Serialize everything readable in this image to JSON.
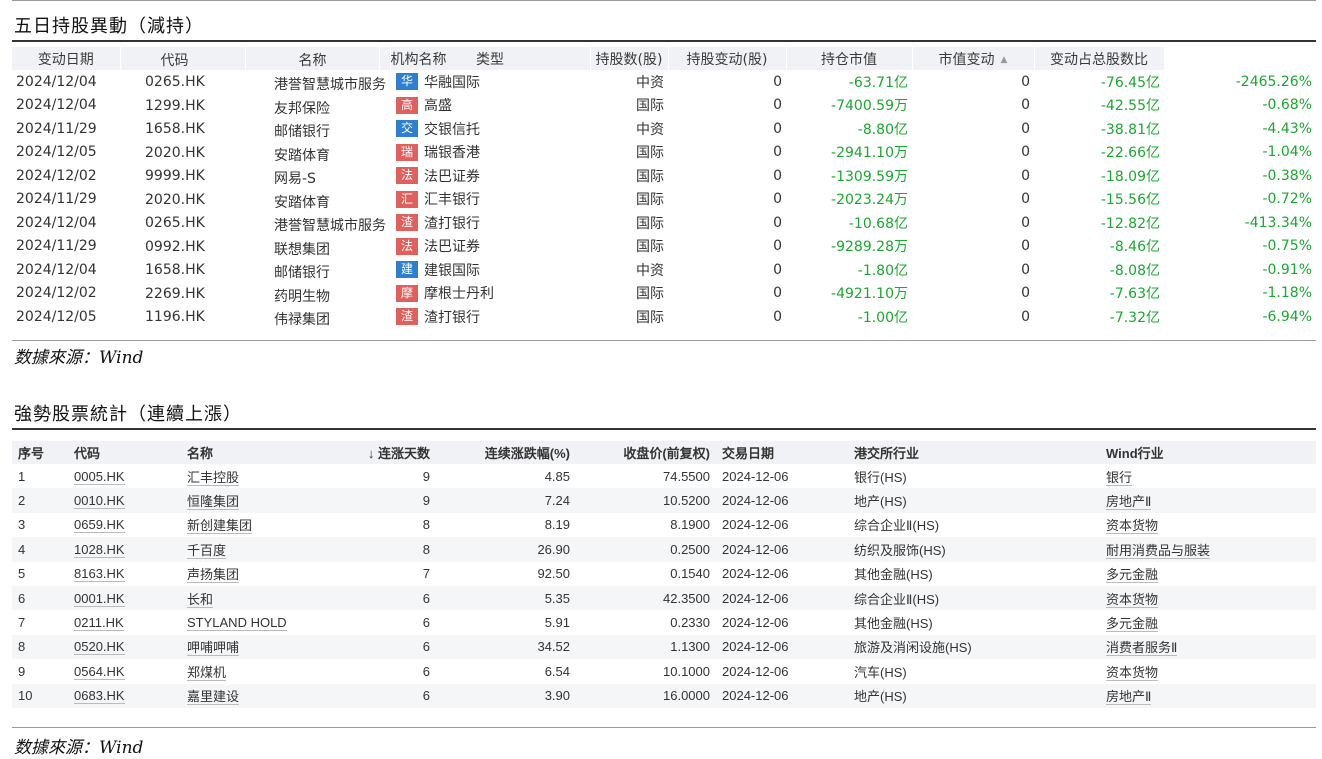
{
  "section1": {
    "title": "五日持股異動（減持）",
    "headers": [
      "变动日期",
      "代码",
      "名称",
      "机构名称",
      "类型",
      "持股数(股)",
      "持股变动(股)",
      "持仓市值",
      "市值变动",
      "变动占总股数比"
    ],
    "rows": [
      {
        "date": "2024/12/04",
        "code": "0265.HK",
        "name": "港誉智慧城市服务",
        "badge": "华",
        "badge_color": "#2e7fd0",
        "inst": "华融国际",
        "type": "中资",
        "shares": "0",
        "change": "-63.71亿",
        "mv": "0",
        "mv_change": "-76.45亿",
        "ratio": "-2465.26%"
      },
      {
        "date": "2024/12/04",
        "code": "1299.HK",
        "name": "友邦保险",
        "badge": "高",
        "badge_color": "#e0605e",
        "inst": "高盛",
        "type": "国际",
        "shares": "0",
        "change": "-7400.59万",
        "mv": "0",
        "mv_change": "-42.55亿",
        "ratio": "-0.68%"
      },
      {
        "date": "2024/11/29",
        "code": "1658.HK",
        "name": "邮储银行",
        "badge": "交",
        "badge_color": "#2e7fd0",
        "inst": "交银信托",
        "type": "中资",
        "shares": "0",
        "change": "-8.80亿",
        "mv": "0",
        "mv_change": "-38.81亿",
        "ratio": "-4.43%"
      },
      {
        "date": "2024/12/05",
        "code": "2020.HK",
        "name": "安踏体育",
        "badge": "瑞",
        "badge_color": "#e0605e",
        "inst": "瑞银香港",
        "type": "国际",
        "shares": "0",
        "change": "-2941.10万",
        "mv": "0",
        "mv_change": "-22.66亿",
        "ratio": "-1.04%"
      },
      {
        "date": "2024/12/02",
        "code": "9999.HK",
        "name": "网易-S",
        "badge": "法",
        "badge_color": "#e0605e",
        "inst": "法巴证券",
        "type": "国际",
        "shares": "0",
        "change": "-1309.59万",
        "mv": "0",
        "mv_change": "-18.09亿",
        "ratio": "-0.38%"
      },
      {
        "date": "2024/11/29",
        "code": "2020.HK",
        "name": "安踏体育",
        "badge": "汇",
        "badge_color": "#e0605e",
        "inst": "汇丰银行",
        "type": "国际",
        "shares": "0",
        "change": "-2023.24万",
        "mv": "0",
        "mv_change": "-15.56亿",
        "ratio": "-0.72%"
      },
      {
        "date": "2024/12/04",
        "code": "0265.HK",
        "name": "港誉智慧城市服务",
        "badge": "渣",
        "badge_color": "#e0605e",
        "inst": "渣打银行",
        "type": "国际",
        "shares": "0",
        "change": "-10.68亿",
        "mv": "0",
        "mv_change": "-12.82亿",
        "ratio": "-413.34%"
      },
      {
        "date": "2024/11/29",
        "code": "0992.HK",
        "name": "联想集团",
        "badge": "法",
        "badge_color": "#e0605e",
        "inst": "法巴证券",
        "type": "国际",
        "shares": "0",
        "change": "-9289.28万",
        "mv": "0",
        "mv_change": "-8.46亿",
        "ratio": "-0.75%"
      },
      {
        "date": "2024/12/04",
        "code": "1658.HK",
        "name": "邮储银行",
        "badge": "建",
        "badge_color": "#2e7fd0",
        "inst": "建银国际",
        "type": "中资",
        "shares": "0",
        "change": "-1.80亿",
        "mv": "0",
        "mv_change": "-8.08亿",
        "ratio": "-0.91%"
      },
      {
        "date": "2024/12/02",
        "code": "2269.HK",
        "name": "药明生物",
        "badge": "摩",
        "badge_color": "#e0605e",
        "inst": "摩根士丹利",
        "type": "国际",
        "shares": "0",
        "change": "-4921.10万",
        "mv": "0",
        "mv_change": "-7.63亿",
        "ratio": "-1.18%"
      },
      {
        "date": "2024/12/05",
        "code": "1196.HK",
        "name": "伟禄集团",
        "badge": "渣",
        "badge_color": "#e0605e",
        "inst": "渣打银行",
        "type": "国际",
        "shares": "0",
        "change": "-1.00亿",
        "mv": "0",
        "mv_change": "-7.32亿",
        "ratio": "-6.94%"
      }
    ],
    "source": "数據來源：Wind"
  },
  "section2": {
    "title": "強勢股票統計（連續上漲）",
    "headers": [
      "序号",
      "代码",
      "名称",
      "↓ 连涨天数",
      "连续涨跌幅(%)",
      "收盘价(前复权)",
      "交易日期",
      "港交所行业",
      "Wind行业"
    ],
    "rows": [
      {
        "no": "1",
        "code": "0005.HK",
        "name": "汇丰控股",
        "days": "9",
        "pct": "4.85",
        "close": "74.5500",
        "date": "2024-12-06",
        "hk_ind": "银行(HS)",
        "wind_ind": "银行"
      },
      {
        "no": "2",
        "code": "0010.HK",
        "name": "恒隆集团",
        "days": "9",
        "pct": "7.24",
        "close": "10.5200",
        "date": "2024-12-06",
        "hk_ind": "地产(HS)",
        "wind_ind": "房地产Ⅱ"
      },
      {
        "no": "3",
        "code": "0659.HK",
        "name": "新创建集团",
        "days": "8",
        "pct": "8.19",
        "close": "8.1900",
        "date": "2024-12-06",
        "hk_ind": "综合企业Ⅱ(HS)",
        "wind_ind": "资本货物"
      },
      {
        "no": "4",
        "code": "1028.HK",
        "name": "千百度",
        "days": "8",
        "pct": "26.90",
        "close": "0.2500",
        "date": "2024-12-06",
        "hk_ind": "纺织及服饰(HS)",
        "wind_ind": "耐用消费品与服装"
      },
      {
        "no": "5",
        "code": "8163.HK",
        "name": "声扬集团",
        "days": "7",
        "pct": "92.50",
        "close": "0.1540",
        "date": "2024-12-06",
        "hk_ind": "其他金融(HS)",
        "wind_ind": "多元金融"
      },
      {
        "no": "6",
        "code": "0001.HK",
        "name": "长和",
        "days": "6",
        "pct": "5.35",
        "close": "42.3500",
        "date": "2024-12-06",
        "hk_ind": "综合企业Ⅱ(HS)",
        "wind_ind": "资本货物"
      },
      {
        "no": "7",
        "code": "0211.HK",
        "name": "STYLAND HOLD",
        "days": "6",
        "pct": "5.91",
        "close": "0.2330",
        "date": "2024-12-06",
        "hk_ind": "其他金融(HS)",
        "wind_ind": "多元金融"
      },
      {
        "no": "8",
        "code": "0520.HK",
        "name": "呷哺呷哺",
        "days": "6",
        "pct": "34.52",
        "close": "1.1300",
        "date": "2024-12-06",
        "hk_ind": "旅游及消闲设施(HS)",
        "wind_ind": "消费者服务Ⅱ"
      },
      {
        "no": "9",
        "code": "0564.HK",
        "name": "郑煤机",
        "days": "6",
        "pct": "6.54",
        "close": "10.1000",
        "date": "2024-12-06",
        "hk_ind": "汽车(HS)",
        "wind_ind": "资本货物"
      },
      {
        "no": "10",
        "code": "0683.HK",
        "name": "嘉里建设",
        "days": "6",
        "pct": "3.90",
        "close": "16.0000",
        "date": "2024-12-06",
        "hk_ind": "地产(HS)",
        "wind_ind": "房地产Ⅱ"
      }
    ],
    "source": "数據來源：Wind"
  }
}
